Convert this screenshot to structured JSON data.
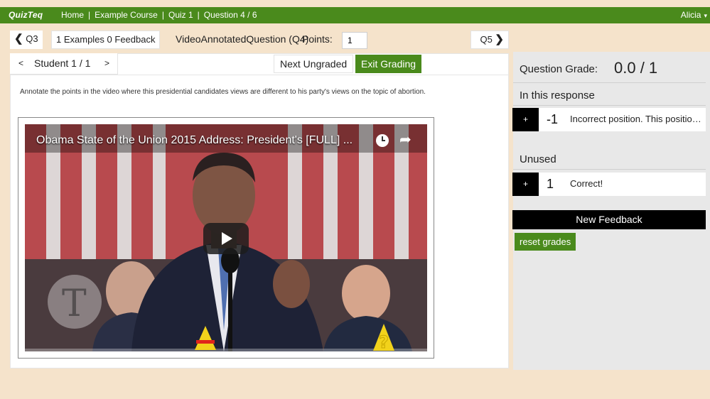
{
  "topbar": {
    "brand": "QuizTeq",
    "crumbs": [
      "Home",
      "Example Course",
      "Quiz 1",
      "Question 4 / 6"
    ],
    "separator": "|",
    "user": "Alicia",
    "user_caret": "▾"
  },
  "question_nav": {
    "prev_label": "Q3",
    "prev_arrow": "❮",
    "examples_feedback": "1 Examples 0 Feedback",
    "question_title": "VideoAnnotatedQuestion (Q4)",
    "points_label": "Points:",
    "points_value": "1",
    "next_label": "Q5",
    "next_arrow": "❯"
  },
  "grading": {
    "prev_student": "<",
    "student_label": "Student 1 / 1",
    "next_student": ">",
    "next_ungraded": "Next Ungraded",
    "exit_grading": "Exit Grading"
  },
  "prompt": "Annotate the points in the video where this presidential candidates views are different to his party's views on the topic of abortion.",
  "video": {
    "title": "Obama State of the Union 2015 Address: President's [FULL] ...",
    "share_glyph": "➦",
    "marker_2_glyph": "?"
  },
  "right_panel": {
    "grade_label": "Question Grade:",
    "grade_value": "0.0 / 1",
    "in_response_label": "In this response",
    "unused_label": "Unused",
    "feedback_in_response": [
      {
        "plus": "+",
        "score": "-1",
        "text": "Incorrect position. This position..."
      }
    ],
    "feedback_unused": [
      {
        "plus": "+",
        "score": "1",
        "text": "Correct!"
      }
    ],
    "new_feedback": "New Feedback",
    "reset_grades": "reset grades"
  },
  "colors": {
    "brand_green": "#4a8a1c",
    "page_bg": "#f5e3cb",
    "panel_gray": "#e8e8e8",
    "marker_yellow": "#f2d21b"
  }
}
